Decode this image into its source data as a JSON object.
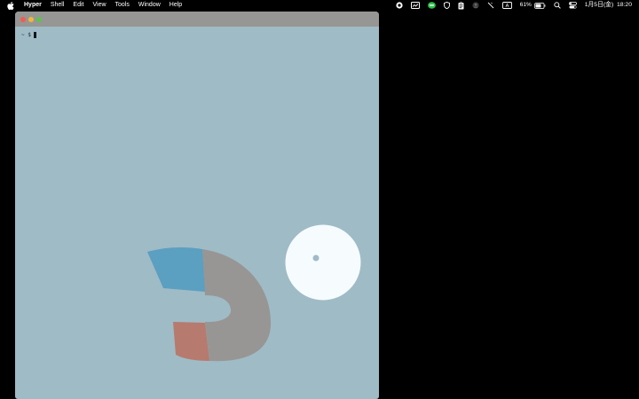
{
  "menubar": {
    "app_name": "Hyper",
    "menus": [
      "Shell",
      "Edit",
      "View",
      "Tools",
      "Window",
      "Help"
    ],
    "battery_percent": "61%",
    "clock": "1月5日(金)  18:20",
    "icons": [
      "apple-logo-icon",
      "record-icon",
      "screen-mirror-icon",
      "line-app-icon",
      "shield-icon",
      "clipboard-icon",
      "face-id-icon",
      "slash-icon",
      "input-source-icon",
      "battery-icon",
      "spotlight-search-icon",
      "control-center-icon"
    ],
    "input_source_label": "A"
  },
  "terminal": {
    "prompt": "~ $"
  },
  "colors": {
    "terminal_background": "#9fbbc6",
    "titlebar": "#969694",
    "arc_gray": "#979694",
    "arc_blue": "#5b9fc1",
    "arc_red": "#b77a6e",
    "disc_white": "#f6fbfe",
    "disc_dot": "#9fbbc6"
  }
}
